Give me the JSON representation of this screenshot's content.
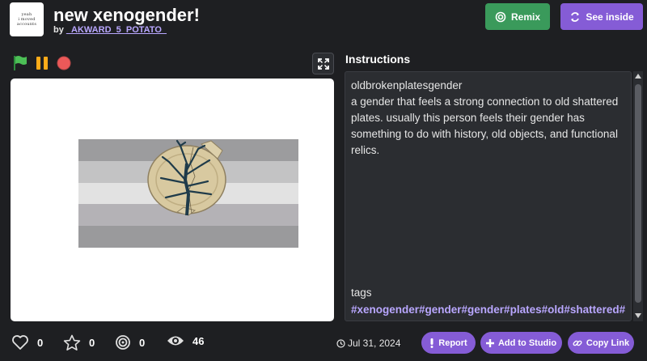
{
  "project": {
    "title": "new xenogender!",
    "by_prefix": "by",
    "author": "_AKWARD_5_POTATO_",
    "thumbnail_text": [
      "yeah",
      "i moved",
      "accounts"
    ]
  },
  "header": {
    "remix_label": "Remix",
    "see_inside_label": "See inside"
  },
  "controls": {
    "green_flag_icon": "green-flag-icon",
    "pause_icon": "pause-icon",
    "stop_icon": "stop-icon",
    "fullscreen_icon": "fullscreen-icon"
  },
  "stage": {
    "flag_stripes": [
      "#9c9c9e",
      "#c3c3c4",
      "#e2e2e2",
      "#b4b2b6",
      "#9a9a9c"
    ],
    "plate_color": "#d8c9a0",
    "tree_color": "#1f3b4a"
  },
  "instructions": {
    "heading": "Instructions",
    "line1": "oldbrokenplatesgender",
    "body": "a gender that feels a strong connection to old shattered plates. usually this person feels their gender has something to do with history, old objects, and functional relics.",
    "tags_label": "tags",
    "tags": "#xenogender#gender#gender#plates#old#shattered#"
  },
  "stats": {
    "loves": "0",
    "favorites": "0",
    "remixes": "0",
    "views": "46"
  },
  "footer": {
    "date": "Jul 31, 2024",
    "report_label": "Report",
    "add_studio_label": "Add to Studio",
    "copy_link_label": "Copy Link"
  },
  "colors": {
    "background": "#1e1f22",
    "remix_green": "#3a9a5b",
    "accent_purple": "#855cd6",
    "tag_color": "#b9a7ff"
  }
}
